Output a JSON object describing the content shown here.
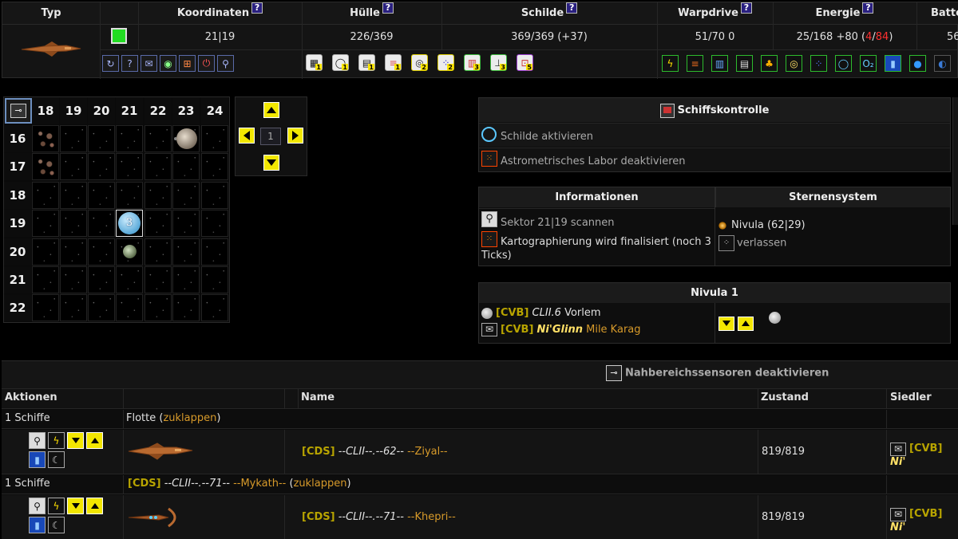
{
  "top_table": {
    "headers": {
      "typ": "Typ",
      "koordinaten": "Koordinaten",
      "huelle": "Hülle",
      "schilde": "Schilde",
      "warpdrive": "Warpdrive",
      "energie": "Energie",
      "batterie": "Batte"
    },
    "help_glyph": "?",
    "values": {
      "koordinaten": "21|19",
      "huelle": "226/369",
      "schilde": "369/369 (+37)",
      "warpdrive": "51/70 0",
      "energie_prefix": "25/168 +80 (",
      "energie_red1": "4",
      "energie_slash": "/",
      "energie_red2": "84",
      "energie_suffix": ")",
      "batterie": "56"
    },
    "status_color": "#22dd22",
    "small_buttons": [
      "refresh-icon",
      "help-icon",
      "mail-icon",
      "database-icon",
      "grid-icon",
      "power-icon",
      "wrench-icon"
    ],
    "system_buttons": [
      {
        "icon": "computer-icon",
        "badge": "1"
      },
      {
        "icon": "ring-icon",
        "badge": "1"
      },
      {
        "icon": "terminal-icon",
        "badge": "1"
      },
      {
        "icon": "stripes-icon",
        "badge": "1"
      },
      {
        "icon": "lens-icon",
        "badge": "2"
      },
      {
        "icon": "dots-icon",
        "badge": "2"
      },
      {
        "icon": "tank-icon",
        "badge": "3"
      },
      {
        "icon": "station-icon",
        "badge": "3"
      },
      {
        "icon": "matrix-icon",
        "badge": "5"
      }
    ],
    "energy_buttons": [
      "lightning-icon",
      "stripes-icon",
      "tank-icon",
      "console-icon",
      "tree-icon",
      "lens-icon",
      "dots-icon",
      "ring-icon",
      "oxygen-icon",
      "blue-panel-icon",
      "sphere-icon",
      "globe-icon"
    ]
  },
  "map": {
    "columns": [
      "18",
      "19",
      "20",
      "21",
      "22",
      "23",
      "24"
    ],
    "rows": [
      "16",
      "17",
      "18",
      "19",
      "20",
      "21",
      "22"
    ],
    "ship_count": "3",
    "page": "1"
  },
  "schiffskontrolle": {
    "title": "Schiffskontrolle",
    "items": [
      "Schilde aktivieren",
      "Astrometrisches Labor deaktivieren"
    ]
  },
  "informationen": {
    "title": "Informationen",
    "scan": "Sektor 21|19 scannen",
    "mapping": "Kartographierung wird finalisiert (noch 3 Ticks)"
  },
  "sternensystem": {
    "title": "Sternensystem",
    "system": "Nivula (62|29)",
    "leave": "verlassen"
  },
  "nivula": {
    "title": "Nivula 1",
    "row1_tag": "[CVB]",
    "row1_class": "CLII.6",
    "row1_name": "Vorlem",
    "row2_tag": "[CVB]",
    "row2_owner": "Ni'Glinn",
    "row2_name": "Mile Karag"
  },
  "sensors": {
    "label": "Nahbereichssensoren deaktivieren"
  },
  "ship_table": {
    "headers": {
      "aktionen": "Aktionen",
      "name": "Name",
      "zustand": "Zustand",
      "siedler": "Siedler"
    },
    "fleet1": {
      "count": "1 Schiffe",
      "label": "Flotte (",
      "toggle": "zuklappen",
      "close": ")"
    },
    "ship1": {
      "tag": "[CDS]",
      "class": "--CLII--.--62--",
      "name": "--Ziyal--",
      "state": "819/819",
      "settler_tag": "[CVB]",
      "settler_name": "Ni'"
    },
    "fleet2": {
      "count": "1 Schiffe",
      "tag": "[CDS]",
      "class": "--CLII--.--71--",
      "name": "--Mykath--",
      "toggle": "zuklappen"
    },
    "ship2": {
      "tag": "[CDS]",
      "class": "--CLII--.--71--",
      "name": "--Khepri--",
      "state": "819/819",
      "settler_tag": "[CVB]",
      "settler_name": "Ni'"
    }
  }
}
